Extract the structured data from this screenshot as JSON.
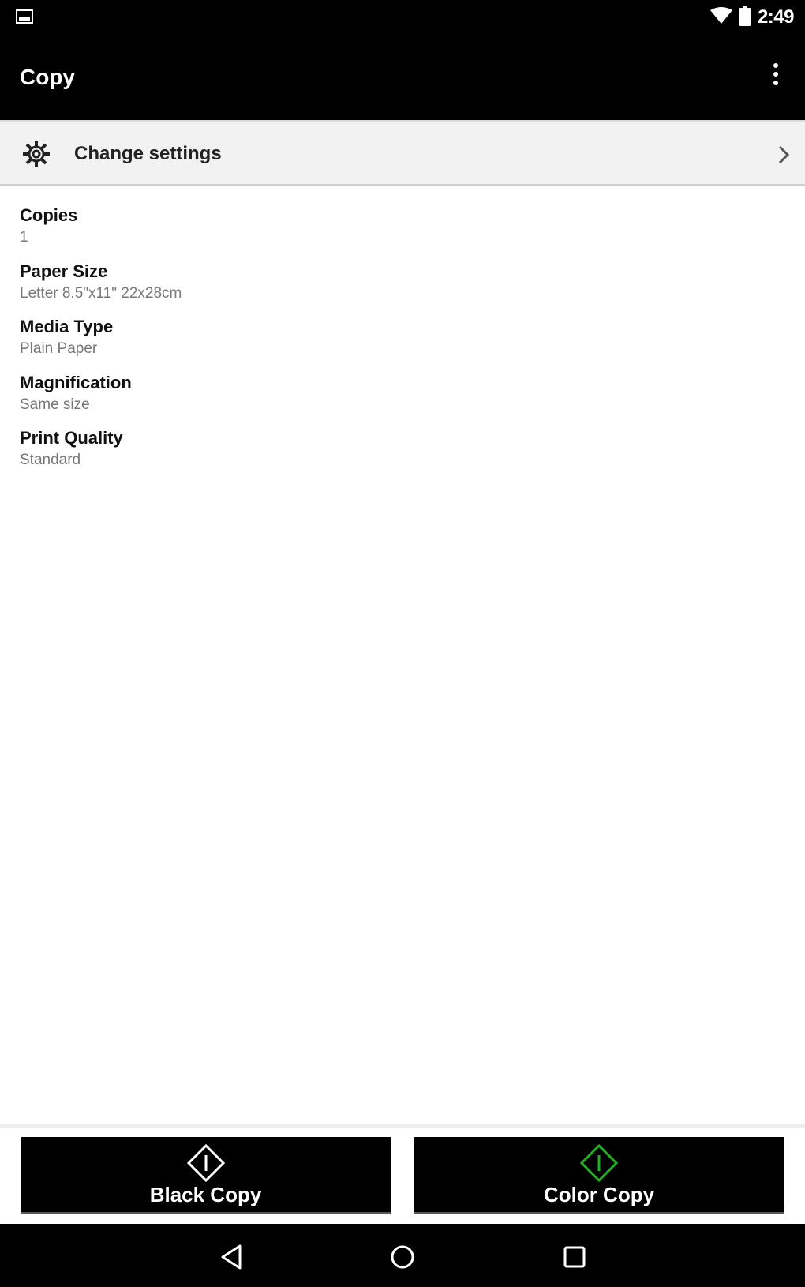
{
  "status_bar": {
    "time": "2:49",
    "icons": [
      "image-notification-icon",
      "wifi-icon",
      "battery-icon"
    ]
  },
  "app_bar": {
    "title": "Copy",
    "overflow_icon": "more-vert-icon"
  },
  "settings_row": {
    "label": "Change settings",
    "icon": "gear-icon",
    "trailing_icon": "chevron-right-icon"
  },
  "settings": [
    {
      "title": "Copies",
      "value": "1"
    },
    {
      "title": "Paper Size",
      "value": "Letter 8.5\"x11\" 22x28cm"
    },
    {
      "title": "Media Type",
      "value": "Plain Paper"
    },
    {
      "title": "Magnification",
      "value": "Same size"
    },
    {
      "title": "Print Quality",
      "value": "Standard"
    }
  ],
  "actions": {
    "black_copy": {
      "label": "Black Copy",
      "icon": "start-diamond-icon",
      "icon_color": "#ffffff"
    },
    "color_copy": {
      "label": "Color Copy",
      "icon": "start-diamond-icon",
      "icon_color": "#22b022"
    }
  },
  "nav_bar": {
    "icons": [
      "back-icon",
      "home-icon",
      "recents-icon"
    ]
  },
  "colors": {
    "bars": "#000000",
    "settings_row_bg": "#f2f2f2",
    "value_text": "#777777",
    "color_copy_accent": "#22b022"
  }
}
